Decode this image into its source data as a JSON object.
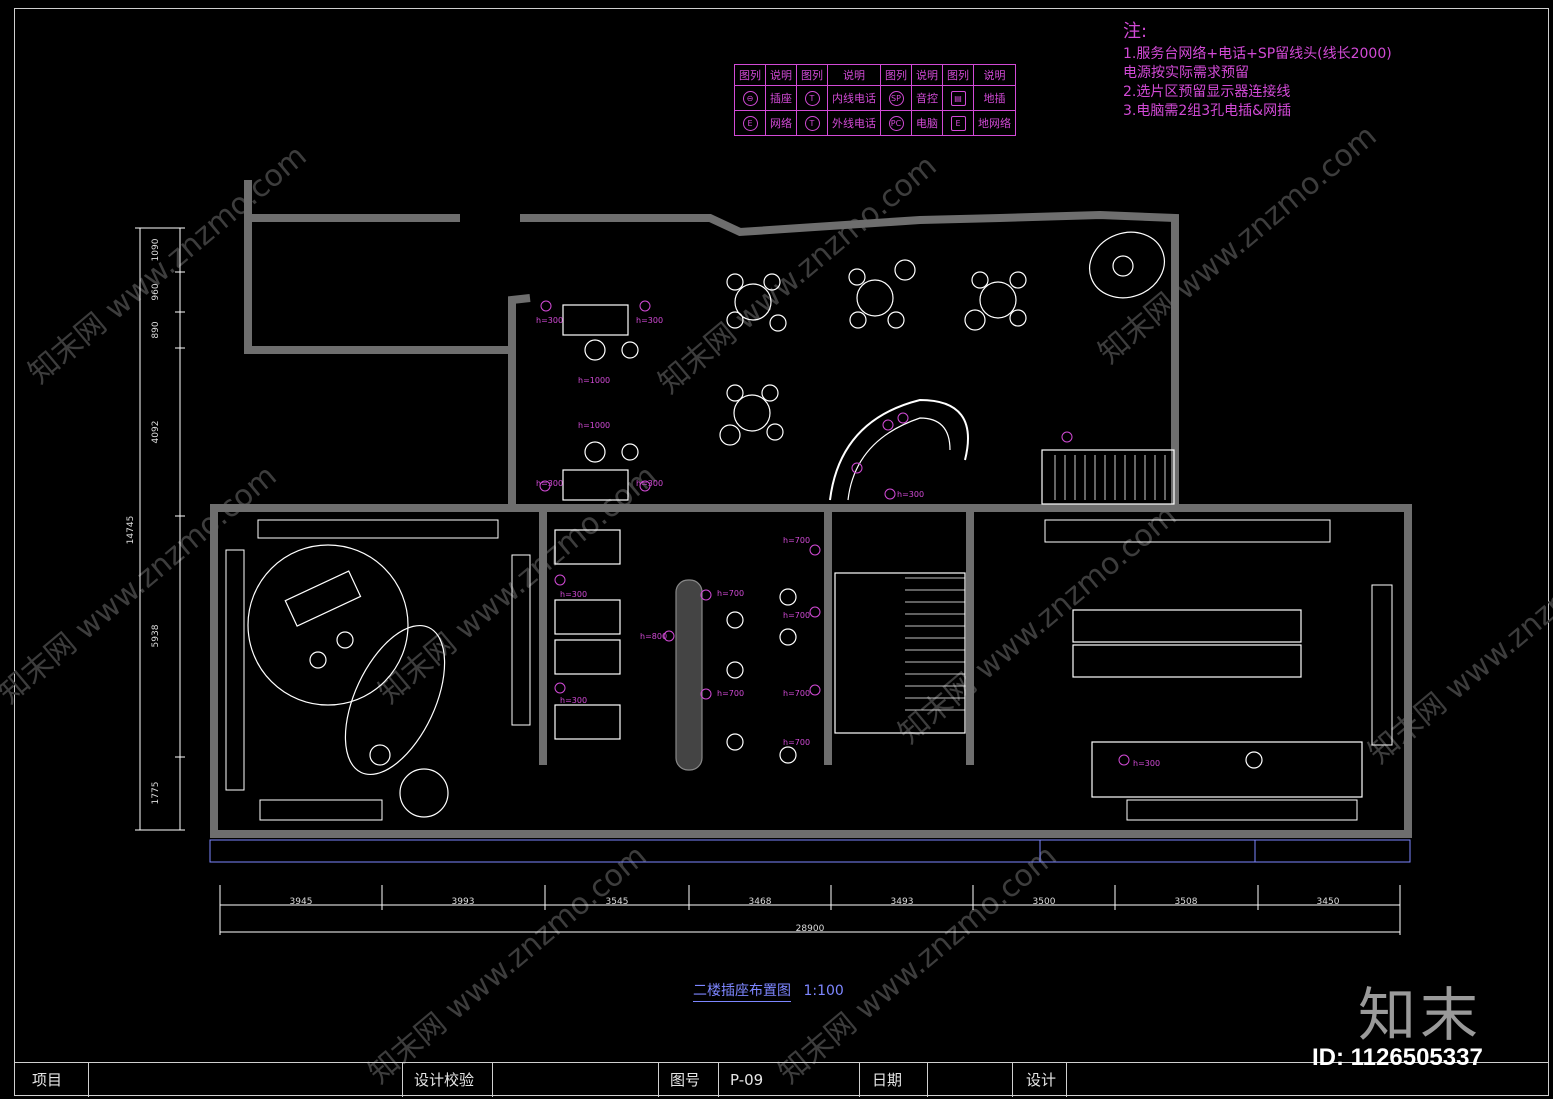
{
  "notes": {
    "heading": "注:",
    "lines": [
      "1.服务台网络+电话+SP留线头(线长2000)",
      "电源按实际需求预留",
      "2.选片区预留显示器连接线",
      "3.电脑需2组3孔电插&网插"
    ]
  },
  "legend": {
    "header": [
      "图列",
      "说明",
      "图列",
      "说明",
      "图列",
      "说明",
      "图列",
      "说明"
    ],
    "rows": [
      [
        {
          "sym": "⊖",
          "label": "插座"
        },
        {
          "sym": "T",
          "label": "内线电话"
        },
        {
          "sym": "SP",
          "label": "音控"
        },
        {
          "sym": "▤",
          "label": "地插"
        }
      ],
      [
        {
          "sym": "E",
          "label": "网络"
        },
        {
          "sym": "T",
          "label": "外线电话"
        },
        {
          "sym": "PC",
          "label": "电脑"
        },
        {
          "sym": "E",
          "label": "地网络"
        }
      ]
    ]
  },
  "dimensions": {
    "bottom": [
      "3945",
      "3993",
      "3545",
      "3468",
      "3493",
      "3500",
      "3508",
      "3450"
    ],
    "total": "28900",
    "left": [
      "1090",
      "960",
      "890",
      "4092",
      "14745",
      "5938",
      "1775"
    ]
  },
  "tags": [
    "h=300",
    "h=300",
    "h=300",
    "h=300",
    "h=300",
    "h=300",
    "h=700",
    "h=700",
    "h=700",
    "h=700",
    "h=700",
    "h=700",
    "h=800",
    "h=300",
    "h=300",
    "h=1000",
    "h=1000"
  ],
  "drawing": {
    "title": "二楼插座布置图",
    "scale": "1:100"
  },
  "titleblock": {
    "project": "项目",
    "check": "设计校验",
    "drawing_no_label": "图号",
    "drawing_no": "P-09",
    "date": "日期",
    "designer": "设计"
  },
  "brand": "知末",
  "image_id": "ID: 1126505337",
  "watermark": "知末网 www.znzmo.com",
  "colors": {
    "background": "#000000",
    "wall": "#6e6e6e",
    "line": "#ffffff",
    "annotation": "#d24ad6",
    "dimension": "#7d86ff"
  }
}
